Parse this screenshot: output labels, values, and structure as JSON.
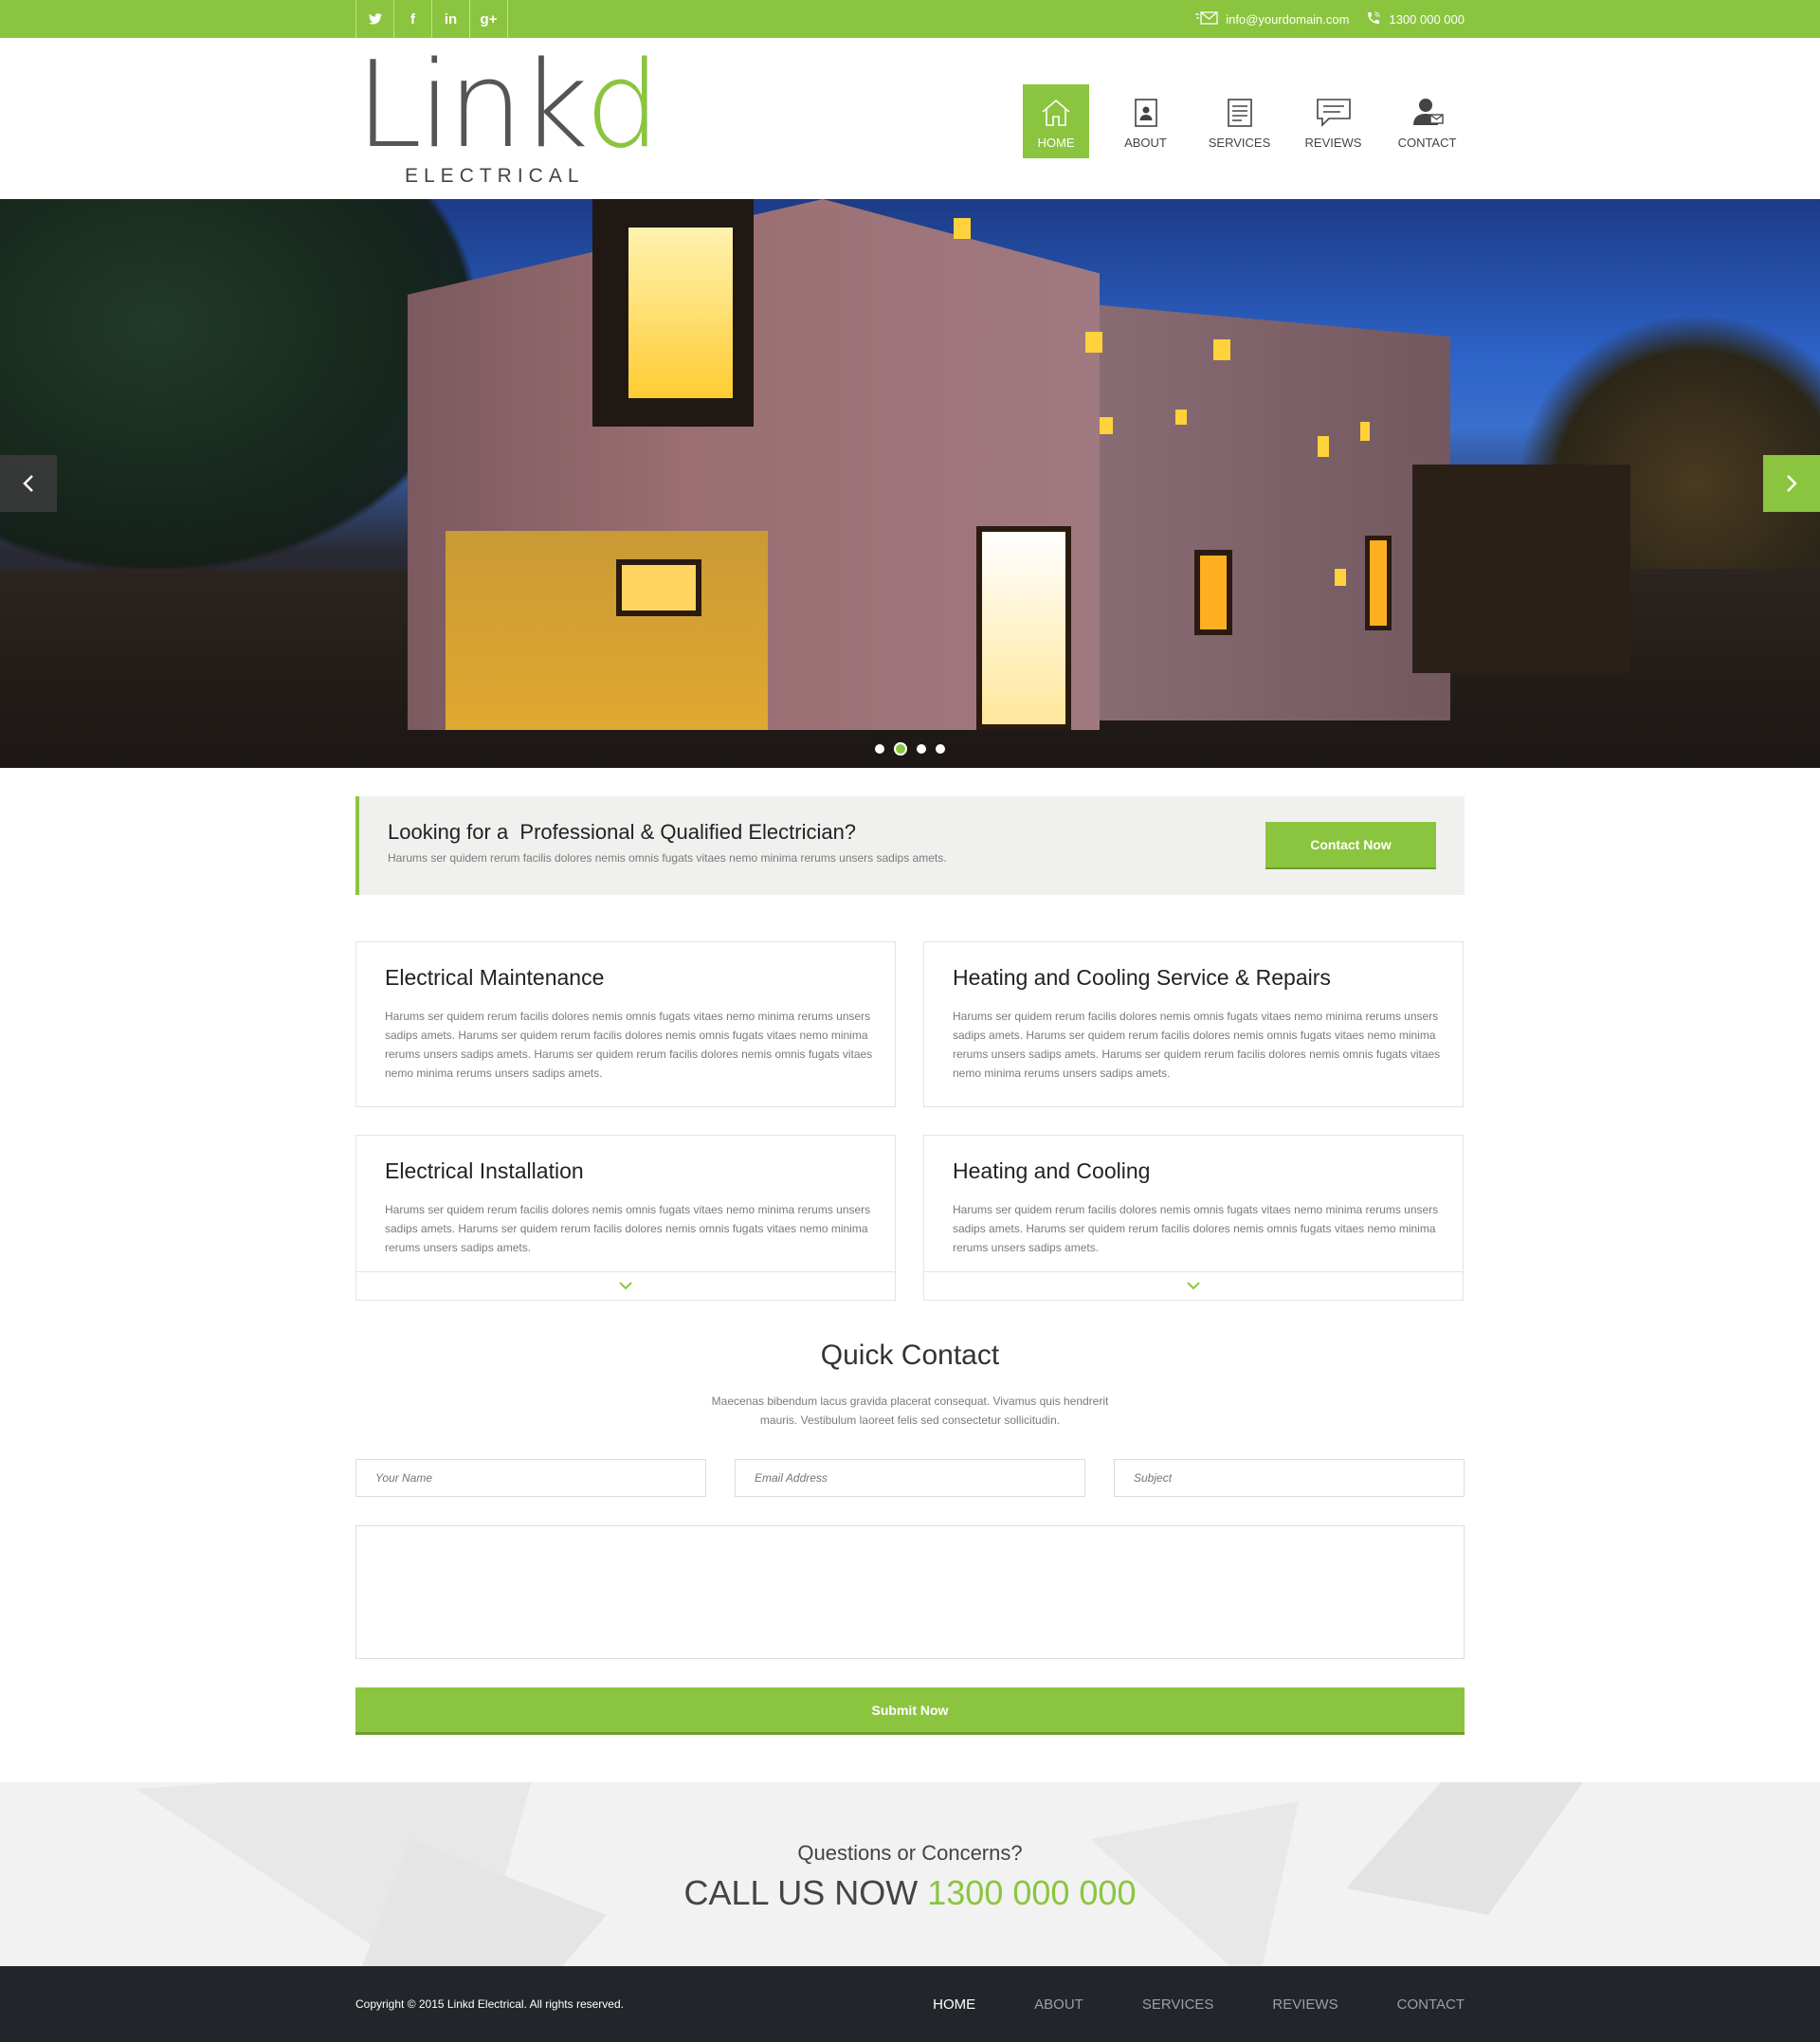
{
  "topbar": {
    "social": [
      {
        "name": "twitter",
        "glyph": "🐦"
      },
      {
        "name": "facebook",
        "glyph": "f"
      },
      {
        "name": "linkedin",
        "glyph": "in"
      },
      {
        "name": "google-plus",
        "glyph": "g+"
      }
    ],
    "email": "info@yourdomain.com",
    "phone": "1300 000 000"
  },
  "logo": {
    "wordmark_main": "Link",
    "wordmark_accent": "d",
    "subtitle": "ELECTRICAL"
  },
  "nav": {
    "items": [
      {
        "label": "HOME",
        "icon": "home-icon",
        "active": true
      },
      {
        "label": "ABOUT",
        "icon": "profile-icon",
        "active": false
      },
      {
        "label": "SERVICES",
        "icon": "document-icon",
        "active": false
      },
      {
        "label": "REVIEWS",
        "icon": "chat-icon",
        "active": false
      },
      {
        "label": "CONTACT",
        "icon": "user-mail-icon",
        "active": false
      }
    ]
  },
  "hero": {
    "prev_glyph": "‹",
    "next_glyph": "›",
    "slides": 4,
    "active_slide": 2
  },
  "promo": {
    "title": "Looking for a  Professional & Qualified Electrician?",
    "text": "Harums ser quidem rerum facilis dolores nemis omnis fugats vitaes nemo minima rerums unsers sadips amets.",
    "button": "Contact Now"
  },
  "services": [
    {
      "title": "Electrical Maintenance",
      "text": "Harums ser quidem rerum facilis dolores nemis omnis fugats vitaes nemo minima rerums unsers sadips amets. Harums ser quidem rerum facilis dolores nemis omnis fugats vitaes nemo minima rerums unsers sadips amets. Harums ser quidem rerum facilis dolores nemis omnis fugats vitaes nemo minima rerums unsers sadips amets."
    },
    {
      "title": "Heating and Cooling Service & Repairs",
      "text": "Harums ser quidem rerum facilis dolores nemis omnis fugats vitaes nemo minima rerums unsers sadips amets. Harums ser quidem rerum facilis dolores nemis omnis fugats vitaes nemo minima rerums unsers sadips amets. Harums ser quidem rerum facilis dolores nemis omnis fugats vitaes nemo minima rerums unsers sadips amets."
    },
    {
      "title": "Electrical Installation",
      "text": "Harums ser quidem rerum facilis dolores nemis omnis fugats vitaes nemo minima rerums unsers sadips amets. Harums ser quidem rerum facilis dolores nemis omnis fugats vitaes nemo minima rerums unsers sadips amets."
    },
    {
      "title": "Heating and Cooling",
      "text": "Harums ser quidem rerum facilis dolores nemis omnis fugats vitaes nemo minima rerums unsers sadips amets. Harums ser quidem rerum facilis dolores nemis omnis fugats vitaes nemo minima rerums unsers sadips amets."
    }
  ],
  "quick_contact": {
    "title": "Quick Contact",
    "text": "Maecenas bibendum lacus gravida placerat consequat. Vivamus quis hendrerit mauris. Vestibulum laoreet felis sed consectetur sollicitudin.",
    "name_placeholder": "Your Name",
    "email_placeholder": "Email Address",
    "subject_placeholder": "Subject",
    "submit": "Submit Now"
  },
  "callband": {
    "question": "Questions or Concerns?",
    "call_prefix": "CALL US NOW",
    "call_number": "1300 000 000"
  },
  "footer": {
    "copyright": "Copyright © 2015 Linkd Electrical. All rights reserved.",
    "nav": [
      "HOME",
      "ABOUT",
      "SERVICES",
      "REVIEWS",
      "CONTACT"
    ]
  },
  "colors": {
    "accent": "#8bc53f",
    "footer_bg": "#22262b",
    "promo_bg": "#f0f0ee"
  }
}
